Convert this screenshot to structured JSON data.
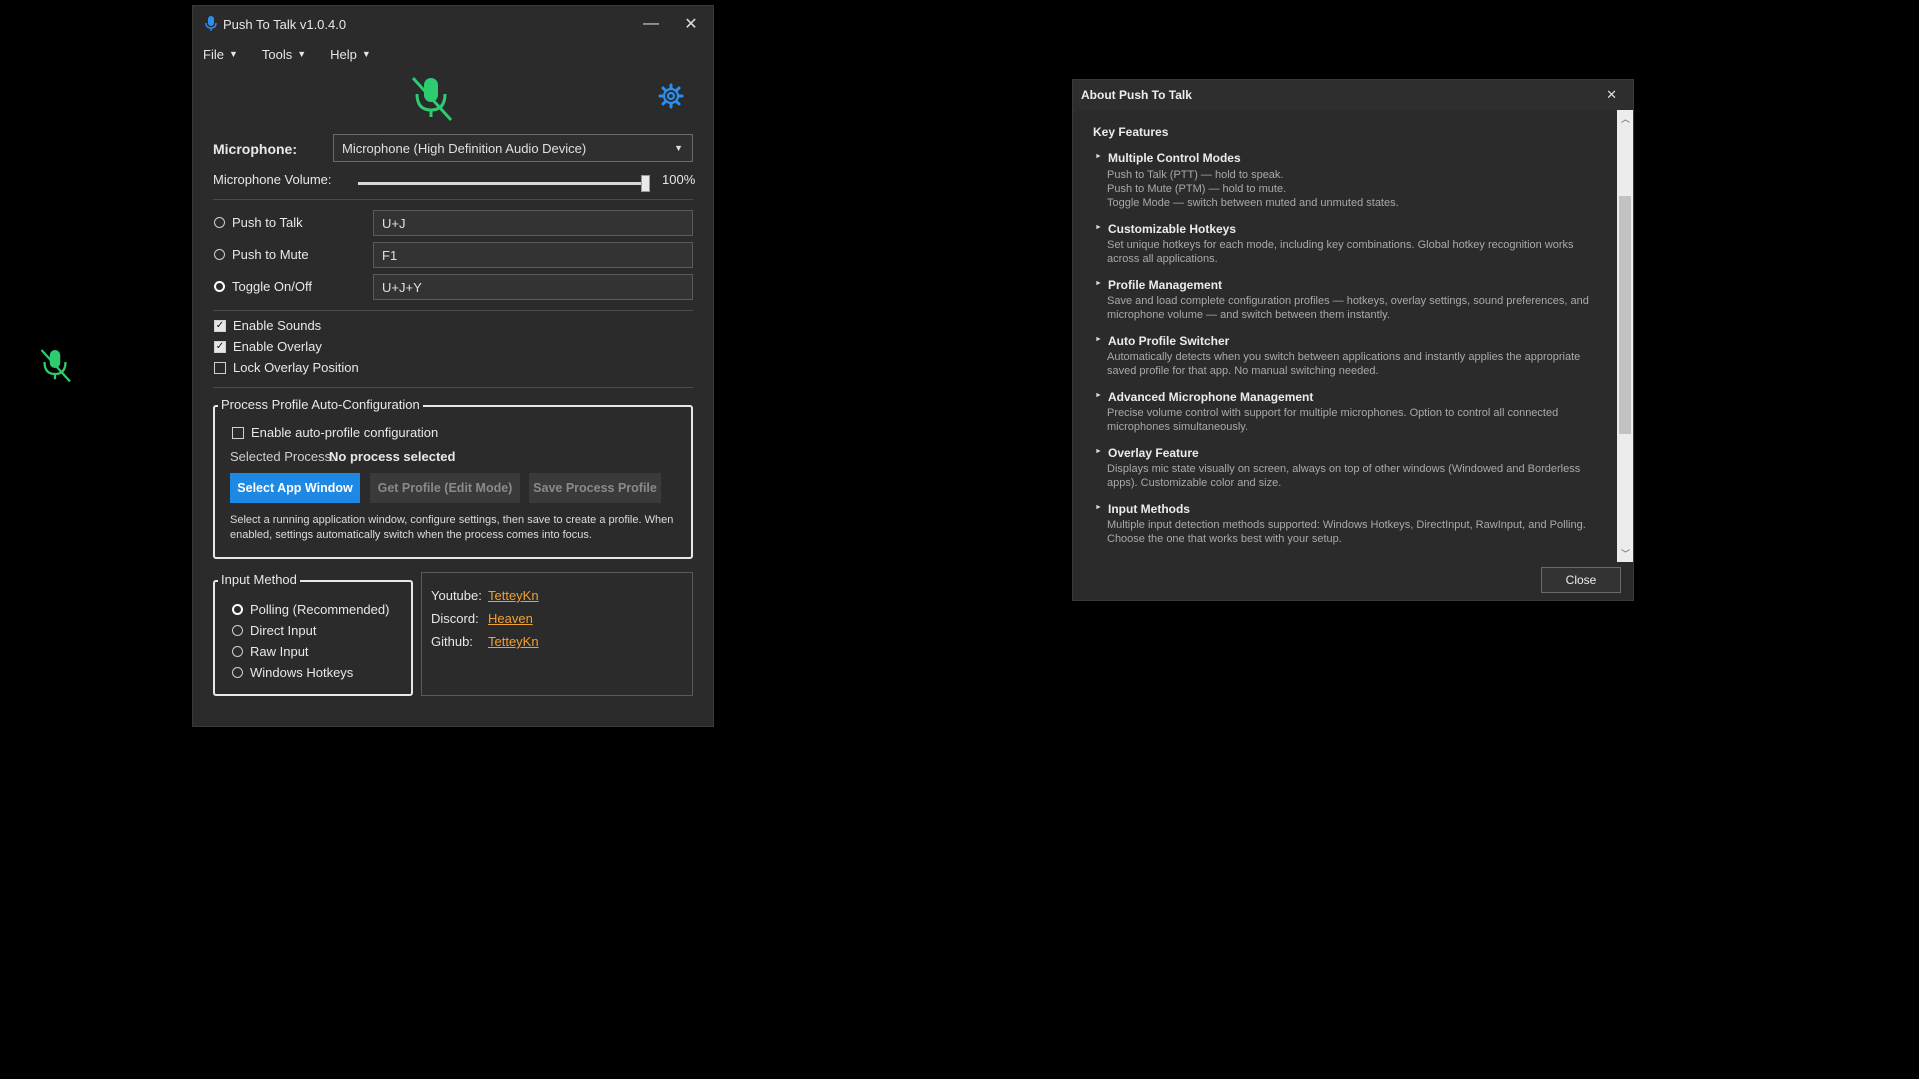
{
  "main_window": {
    "title": "Push To Talk v1.0.4.0",
    "minimize_glyph": "—",
    "close_glyph": "✕",
    "menus": [
      {
        "label": "File"
      },
      {
        "label": "Tools"
      },
      {
        "label": "Help"
      }
    ],
    "status_icon": "mic-muted-icon",
    "settings_icon": "gear-icon",
    "microphone": {
      "label": "Microphone:",
      "selected": "Microphone (High Definition Audio Device)"
    },
    "volume": {
      "label": "Microphone Volume:",
      "value_text": "100%",
      "value": 1.0
    },
    "modes": [
      {
        "label": "Push to Talk",
        "hotkey": "U+J",
        "selected": false
      },
      {
        "label": "Push to Mute",
        "hotkey": "F1",
        "selected": false
      },
      {
        "label": "Toggle On/Off",
        "hotkey": "U+J+Y",
        "selected": true
      }
    ],
    "options": [
      {
        "label": "Enable Sounds",
        "checked": true
      },
      {
        "label": "Enable Overlay",
        "checked": true
      },
      {
        "label": "Lock Overlay Position",
        "checked": false
      }
    ],
    "process_profile": {
      "group_title": "Process Profile Auto-Configuration",
      "enable_label": "Enable auto-profile configuration",
      "enabled": false,
      "selected_process_label": "Selected Process:",
      "selected_process_value": "No process selected",
      "select_button": "Select App Window",
      "get_button": "Get Profile (Edit Mode)",
      "save_button": "Save Process Profile",
      "help_text": "Select a running application window, configure settings, then save to create a profile. When enabled, settings automatically switch when the process comes into focus."
    },
    "input_method": {
      "group_title": "Input Method",
      "options": [
        {
          "label": "Polling (Recommended)",
          "selected": true
        },
        {
          "label": "Direct Input",
          "selected": false
        },
        {
          "label": "Raw Input",
          "selected": false
        },
        {
          "label": "Windows Hotkeys",
          "selected": false
        }
      ]
    },
    "links": [
      {
        "label": "Youtube:",
        "value": "TetteyKn"
      },
      {
        "label": "Discord:",
        "value": "Heaven"
      },
      {
        "label": "Github:",
        "value": "TetteyKn"
      }
    ]
  },
  "overlay": {
    "icon": "mic-muted-icon",
    "accent": "#2ecc71"
  },
  "about_dialog": {
    "title": "About Push To Talk",
    "close_glyph": "✕",
    "heading": "Key Features",
    "features": [
      {
        "title": "Multiple Control Modes",
        "desc": [
          "Push to Talk (PTT) — hold to speak.",
          "Push to Mute (PTM) — hold to mute.",
          "Toggle Mode — switch between muted and unmuted states."
        ]
      },
      {
        "title": "Customizable Hotkeys",
        "desc": [
          "Set unique hotkeys for each mode, including key combinations. Global hotkey recognition works",
          "across all applications."
        ]
      },
      {
        "title": "Profile Management",
        "desc": [
          "Save and load complete configuration profiles — hotkeys, overlay settings, sound preferences, and",
          "microphone volume — and switch between them instantly."
        ]
      },
      {
        "title": "Auto Profile Switcher",
        "desc": [
          "Automatically detects when you switch between applications and instantly applies the appropriate",
          "saved profile for that app. No manual switching needed."
        ]
      },
      {
        "title": "Advanced Microphone Management",
        "desc": [
          "Precise volume control with support for multiple microphones. Option to control all connected",
          "microphones simultaneously."
        ]
      },
      {
        "title": "Overlay Feature",
        "desc": [
          "Displays mic state visually on screen, always on top of other windows (Windowed and Borderless",
          "apps). Customizable color and size."
        ]
      },
      {
        "title": "Input Methods",
        "desc": [
          "Multiple input detection methods supported: Windows Hotkeys, DirectInput, RawInput, and Polling.",
          "Choose the one that works best with your setup."
        ]
      }
    ],
    "close_button": "Close"
  },
  "colors": {
    "accent_blue": "#1e88e5",
    "mic_green": "#2ecc71",
    "link_orange": "#f0a030",
    "window_bg": "#2b2b2b"
  }
}
